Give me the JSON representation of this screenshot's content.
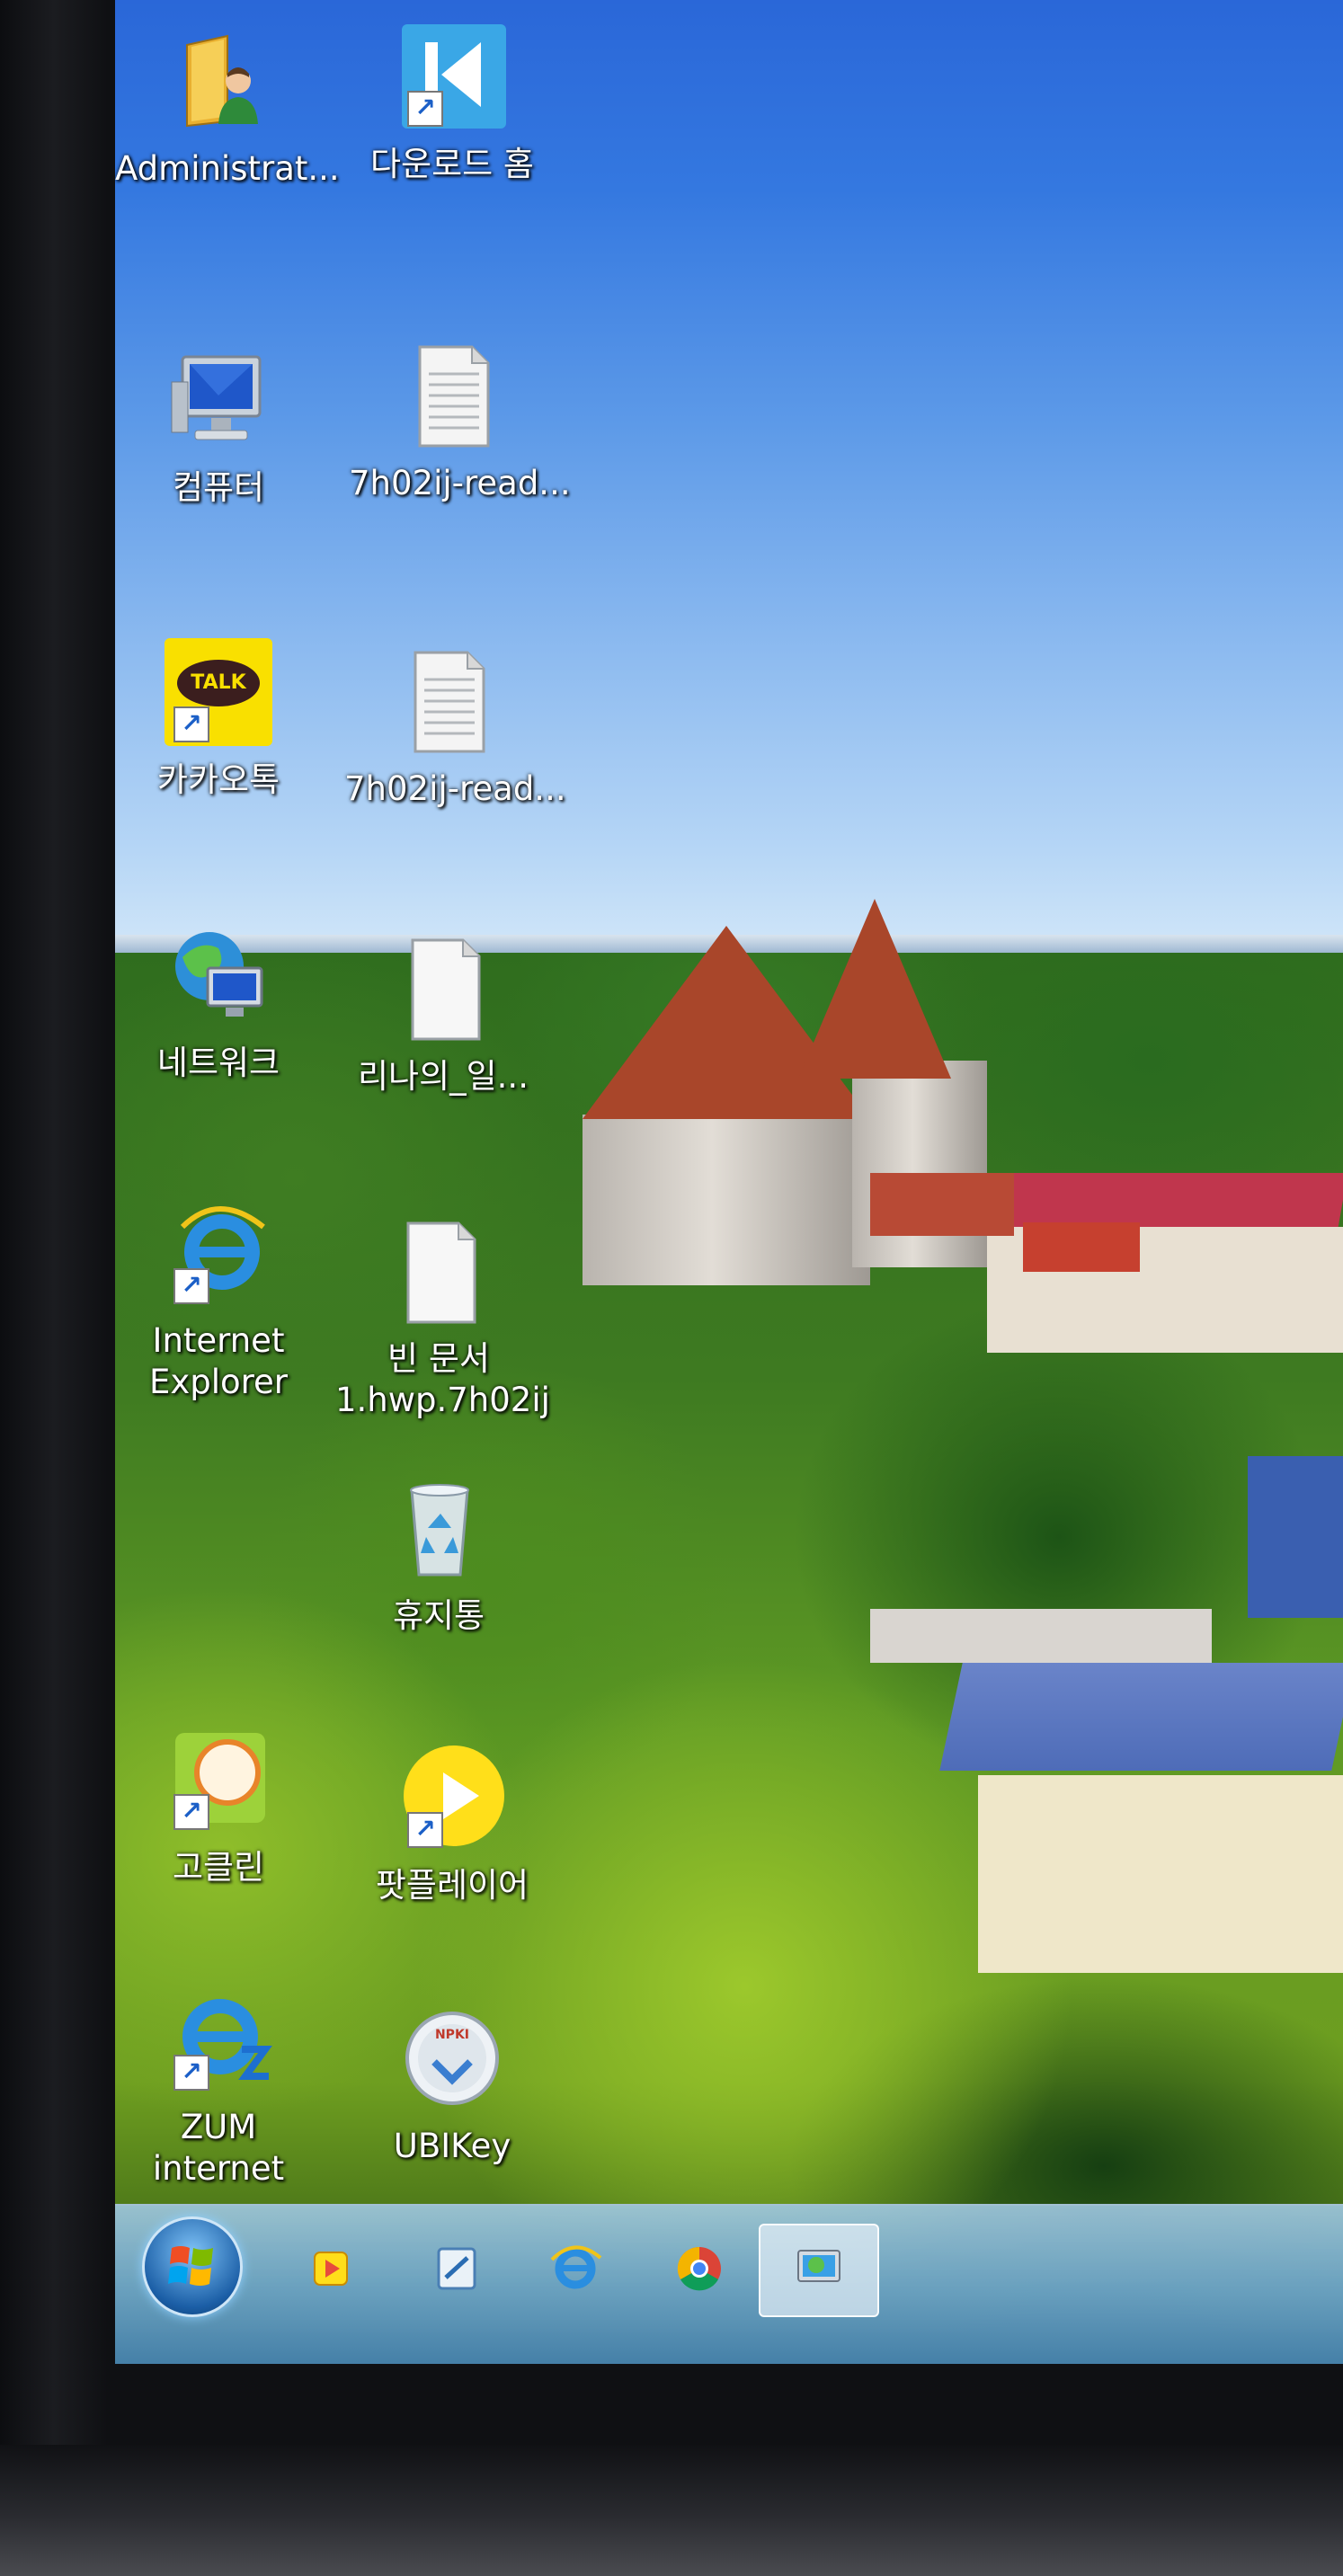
{
  "desktop": {
    "icons": [
      {
        "label": "Administrat..."
      },
      {
        "label": "다운로드 홈"
      },
      {
        "label": "컴퓨터"
      },
      {
        "label": "7h02ij-read..."
      },
      {
        "label": "카카오톡"
      },
      {
        "label": "7h02ij-read..."
      },
      {
        "label": "네트워크"
      },
      {
        "label": "리나의_일..."
      },
      {
        "label": "Internet\nExplorer"
      },
      {
        "label": "빈 문서\n1.hwp.7h02ij"
      },
      {
        "label": "휴지통"
      },
      {
        "label": "고클린"
      },
      {
        "label": "팟플레이어"
      },
      {
        "label": "ZUM\ninternet"
      },
      {
        "label": "UBIKey"
      }
    ],
    "kakao_badge": "TALK",
    "ubikey_badge": "NPKI"
  },
  "taskbar": {
    "items": [
      {
        "name": "start"
      },
      {
        "name": "potplayer"
      },
      {
        "name": "hancom"
      },
      {
        "name": "internet-explorer"
      },
      {
        "name": "chrome"
      },
      {
        "name": "network"
      }
    ]
  },
  "colors": {
    "sky_top": "#2a67d8",
    "roof": "#a9462a",
    "kakao_yellow": "#f9e000"
  }
}
